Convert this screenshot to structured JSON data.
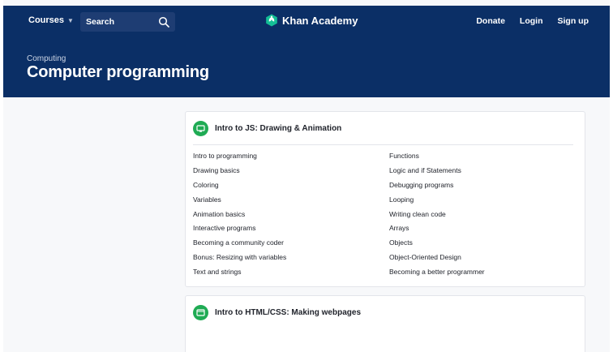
{
  "header": {
    "courses_label": "Courses",
    "search_label": "Search",
    "brand_name": "Khan Academy",
    "nav": [
      "Donate",
      "Login",
      "Sign up"
    ]
  },
  "hero": {
    "breadcrumb": "Computing",
    "title": "Computer programming"
  },
  "units": [
    {
      "title": "Intro to JS: Drawing & Animation",
      "left": [
        "Intro to programming",
        "Drawing basics",
        "Coloring",
        "Variables",
        "Animation basics",
        "Interactive programs",
        "Becoming a community coder",
        "Bonus: Resizing with variables",
        "Text and strings"
      ],
      "right": [
        "Functions",
        "Logic and if Statements",
        "Debugging programs",
        "Looping",
        "Writing clean code",
        "Arrays",
        "Objects",
        "Object-Oriented Design",
        "Becoming a better programmer"
      ]
    },
    {
      "title": "Intro to HTML/CSS: Making webpages"
    }
  ],
  "colors": {
    "header_bg": "#0b2f66",
    "unit_icon": "#1fab54",
    "page_bg": "#f7f8fa"
  }
}
